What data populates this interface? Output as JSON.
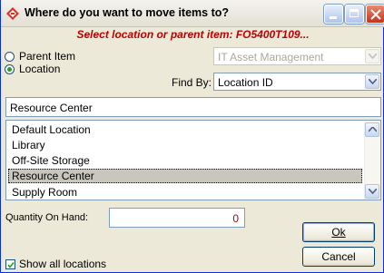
{
  "window": {
    "title": "Where do you want to move items to?",
    "subtitle": "Select location or parent item: FO5400T109..."
  },
  "move_target": {
    "options": [
      {
        "label": "Parent Item",
        "selected": false
      },
      {
        "label": "Location",
        "selected": true
      }
    ],
    "parent_combo_value": "IT Asset Management",
    "find_by_label": "Find By:",
    "find_by_value": "Location ID"
  },
  "search_value": "Resource Center",
  "locations": {
    "items": [
      "Default Location",
      "Library",
      "Off-Site Storage",
      "Resource Center",
      "Supply Room"
    ],
    "selected": "Resource Center"
  },
  "quantity": {
    "label": "Quantity On Hand:",
    "value": "0"
  },
  "buttons": {
    "ok": "Ok",
    "cancel": "Cancel"
  },
  "show_all": {
    "label": "Show all locations",
    "checked": true
  },
  "colors": {
    "subtitle": "#c00000",
    "window_border": "#0831d9",
    "selection": "#c9c6bd"
  },
  "icons": [
    "app-icon",
    "minimize-icon",
    "maximize-icon",
    "close-icon",
    "chevron-down-icon",
    "scroll-up-icon",
    "scroll-down-icon",
    "check-icon"
  ]
}
